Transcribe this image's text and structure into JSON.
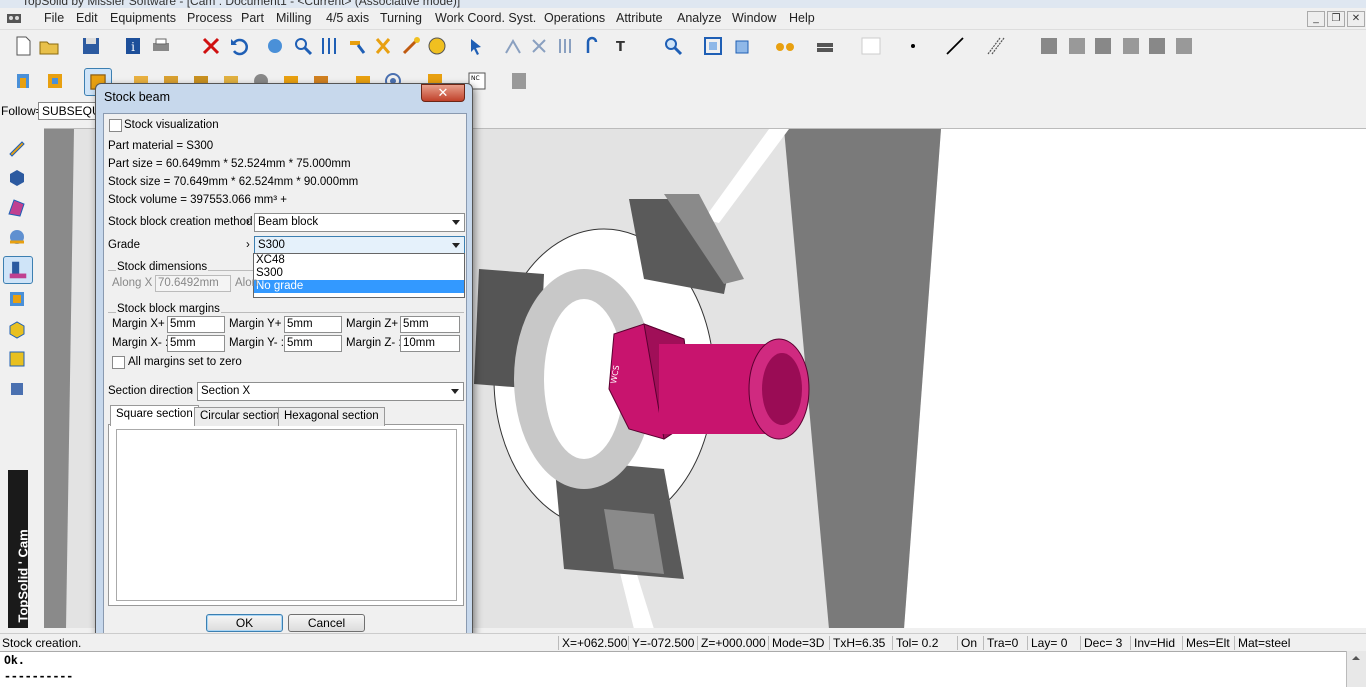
{
  "window": {
    "title": "TopSolid by Missler Software - [Cam : Document1 - <Current> (Associative mode)]"
  },
  "menu": [
    "File",
    "Edit",
    "Equipments",
    "Process",
    "Part",
    "Milling",
    "4/5 axis",
    "Turning",
    "Work Coord. Syst.",
    "Operations",
    "Attribute",
    "Analyze",
    "Window",
    "Help"
  ],
  "follow": {
    "label": "Follow=",
    "value": "SUBSEQU"
  },
  "brand": "TopSolid ' Cam",
  "dialog": {
    "title": "Stock beam",
    "close": "✕",
    "stock_visualization": "Stock visualization",
    "part_material": "Part material = S300",
    "part_size": "Part size = 60.649mm * 52.524mm * 75.000mm",
    "stock_size": "Stock size = 70.649mm * 62.524mm * 90.000mm",
    "stock_volume": "Stock volume = 397553.066 mm³ +",
    "creation_method_label": "Stock block creation method",
    "creation_method_value": "Beam block",
    "grade_label": "Grade",
    "grade_value": "S300",
    "grade_options": [
      "XC48",
      "S300",
      "No grade"
    ],
    "dimensions_title": "Stock dimensions",
    "along_x_label": "Along X :",
    "along_x_value": "70.6492mm",
    "along_y_label": "Alon",
    "margins_title": "Stock block margins",
    "margin_xp_label": "Margin X+ :",
    "margin_xp": "5mm",
    "margin_yp_label": "Margin Y+ :",
    "margin_yp": "5mm",
    "margin_zp_label": "Margin Z+ :",
    "margin_zp": "5mm",
    "margin_xm_label": "Margin X- :",
    "margin_xm": "5mm",
    "margin_ym_label": "Margin Y- :",
    "margin_ym": "5mm",
    "margin_zm_label": "Margin Z- :",
    "margin_zm": "10mm",
    "all_margins_zero": "All margins set to zero",
    "section_direction_label": "Section direction",
    "section_direction_value": "Section X",
    "tabs": [
      "Square section",
      "Circular section",
      "Hexagonal section"
    ],
    "ok": "OK",
    "cancel": "Cancel"
  },
  "status": {
    "message": "Stock creation.",
    "x": "X=+062.500",
    "y": "Y=-072.500",
    "z": "Z=+000.000",
    "mode": "Mode=3D",
    "txh": "TxH=6.35",
    "tol": "Tol=  0.2",
    "on": "On",
    "tra": "Tra=0",
    "lay": "Lay=  0",
    "dec": "Dec= 3",
    "inv": "Inv=Hid",
    "mes": "Mes=Elt",
    "mat": "Mat=steel"
  },
  "console": {
    "line1": "Ok.",
    "line2": "----------"
  },
  "colors": {
    "part": "#c8146e",
    "chuck": "#5a5a5a",
    "dialog_frame": "#c7d8ec",
    "selection": "#3399ff"
  }
}
